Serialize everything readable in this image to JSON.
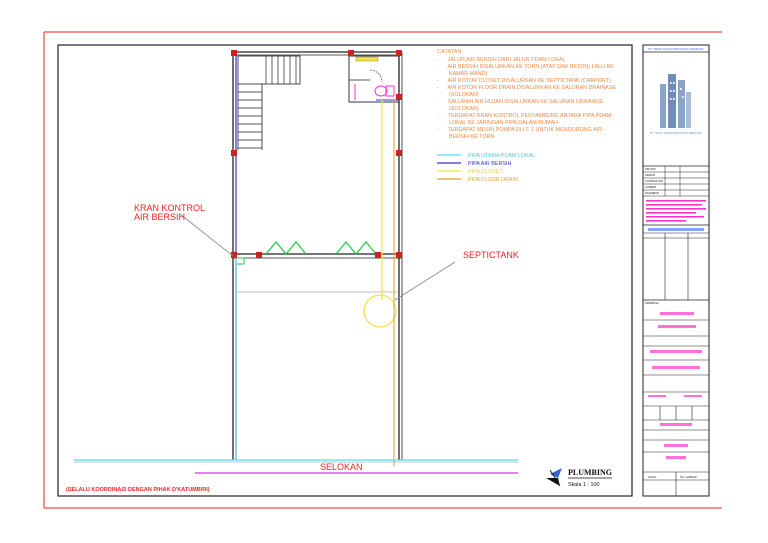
{
  "notes": {
    "heading": "CATATAN",
    "lines": [
      "-      JALUR AIR BERSIH DARI JALUR PDAM LOKAL",
      "-      AIR BERSIH DISALURKAN KE TORN (ATAP DAK BETON) LALU KE",
      "        KAMAR MANDI",
      "-      AIR KOTOR CLOSET DISALURKAN KE SEPTICTANK (CARPORT)",
      "-      AIR KOTOR FLOOR DRAIN DISALURKAN KE SALURAN DRAINASE",
      "        (SOLOKAN)",
      "-      SALURAN AIR HUJAN DISALURKAN KE SALURAN DRAINASE",
      "        (SOLOKAN)",
      "-      TERDAPAT KRAN KONTROL PENYAMBUNG ANTARA PIPA PDAM",
      "        LOKAL KE JARINGAN PIPA DALAM RUMAH",
      "-      TERDAPAT MESIN POMPA DI LT. 1 UNTUK MENDORONG AIR",
      "        BERSIH KE TORN"
    ]
  },
  "legend": [
    {
      "label": "PIPA UTAMA PDAM LOKAL",
      "color": "#55ddee"
    },
    {
      "label": "PIPA AIR BERSIH",
      "color": "#3333cc"
    },
    {
      "label": "PIPA CLOSET",
      "color": "#f2e04a"
    },
    {
      "label": "PIPA FLOOR DRAIN",
      "color": "#e0a030"
    }
  ],
  "callouts": {
    "kran_line1": "KRAN KONTROL",
    "kran_line2": "AIR BERSIH",
    "septic": "SEPTICTANK",
    "selokan": "SELOKAN",
    "footer_note": "(SELALU KOORDINASI DENGAN PIHAK D'KATUMBIRI)"
  },
  "title_mark": {
    "title": "PLUMBING",
    "scale": "Skala 1 : 100"
  },
  "title_block": {
    "top_name": "PT. TRIAS DUAKONSTRUKSI PERKASA",
    "logo_caption": "PT. TRIAS DUAKONSTRUKSI PERKASA",
    "cells": [
      "PROYEK",
      "PEMILIK",
      "KONTRAKTOR",
      "GAMBAR",
      "DIGAMBAR",
      "DIPERIKSA",
      "DISETUJUI",
      "NO. GAMBAR",
      "SKALA"
    ],
    "accent_pink": "#ff33cc",
    "accent_blue": "#3366ff",
    "accent_red": "#ee2222"
  },
  "colors": {
    "frame": "#ee2222",
    "walls": "#222222",
    "clean_water": "#3333cc",
    "pdam": "#55ddee",
    "closet": "#f2e04a",
    "floor_drain": "#e0a030",
    "callout": "#ee2222",
    "leader": "#888888",
    "green_gutter": "#22cc44",
    "selokan_line": "#dd33ee",
    "column": "#cc2222"
  }
}
